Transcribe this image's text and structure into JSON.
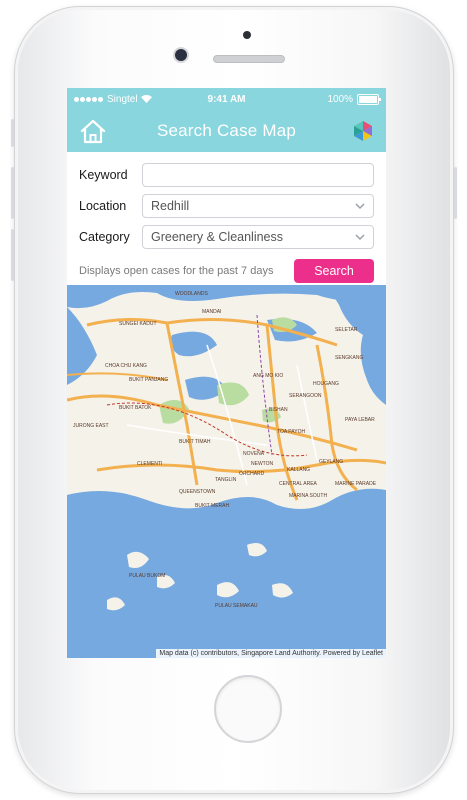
{
  "status_bar": {
    "carrier": "Singtel",
    "time": "9:41 AM",
    "battery": "100%"
  },
  "nav": {
    "title": "Search Case Map"
  },
  "form": {
    "keyword_label": "Keyword",
    "keyword_value": "",
    "location_label": "Location",
    "location_value": "Redhill",
    "category_label": "Category",
    "category_value": "Greenery & Cleanliness",
    "hint": "Displays open cases for the past 7 days",
    "search_label": "Search"
  },
  "map": {
    "attribution": "Map data (c) contributors, Singapore Land Authority. Powered by Leaflet",
    "place_labels": [
      "WOODLANDS",
      "MANDAI",
      "SUNGEI KADUT",
      "CHOA CHU KANG",
      "BUKIT PANJANG",
      "BUKIT BATOK",
      "JURONG EAST",
      "CLEMENTI",
      "BUKIT TIMAH",
      "ANG MO KIO",
      "SERANGOON",
      "SELETAR",
      "SENGKANG",
      "HOUGANG",
      "BISHAN",
      "TOA PAYOH",
      "PAYA LEBAR",
      "NOVENA",
      "NEWTON",
      "TANGLIN",
      "ORCHARD",
      "KALLANG",
      "GEYLANG",
      "MARINE PARADE",
      "QUEENSTOWN",
      "BUKIT MERAH",
      "CENTRAL AREA",
      "MARINA SOUTH",
      "PULAU BUKOM",
      "PULAU SEMAKAU"
    ],
    "colors": {
      "land": "#f5f2ea",
      "water": "#76a9e0",
      "park": "#b9dca0",
      "road": "#f3b04f"
    }
  }
}
